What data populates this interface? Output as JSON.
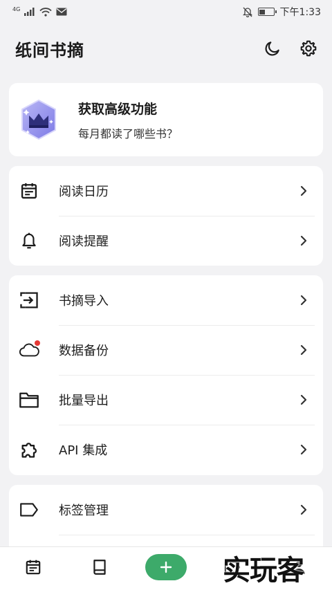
{
  "status_bar": {
    "network": "4G",
    "time": "下午1:33"
  },
  "header": {
    "title": "纸间书摘"
  },
  "premium": {
    "title": "获取高级功能",
    "subtitle": "每月都读了哪些书？"
  },
  "group1": {
    "items": [
      {
        "label": "阅读日历",
        "icon": "calendar-icon"
      },
      {
        "label": "阅读提醒",
        "icon": "bell-icon"
      }
    ]
  },
  "group2": {
    "items": [
      {
        "label": "书摘导入",
        "icon": "import-icon"
      },
      {
        "label": "数据备份",
        "icon": "cloud-icon"
      },
      {
        "label": "批量导出",
        "icon": "folder-icon"
      },
      {
        "label": "API 集成",
        "icon": "puzzle-icon"
      }
    ]
  },
  "group3": {
    "items": [
      {
        "label": "标签管理",
        "icon": "tag-icon"
      }
    ]
  },
  "watermark": "实玩客",
  "colors": {
    "accent": "#3daa6a",
    "badge": "#e53935",
    "background": "#f2f2f4"
  }
}
